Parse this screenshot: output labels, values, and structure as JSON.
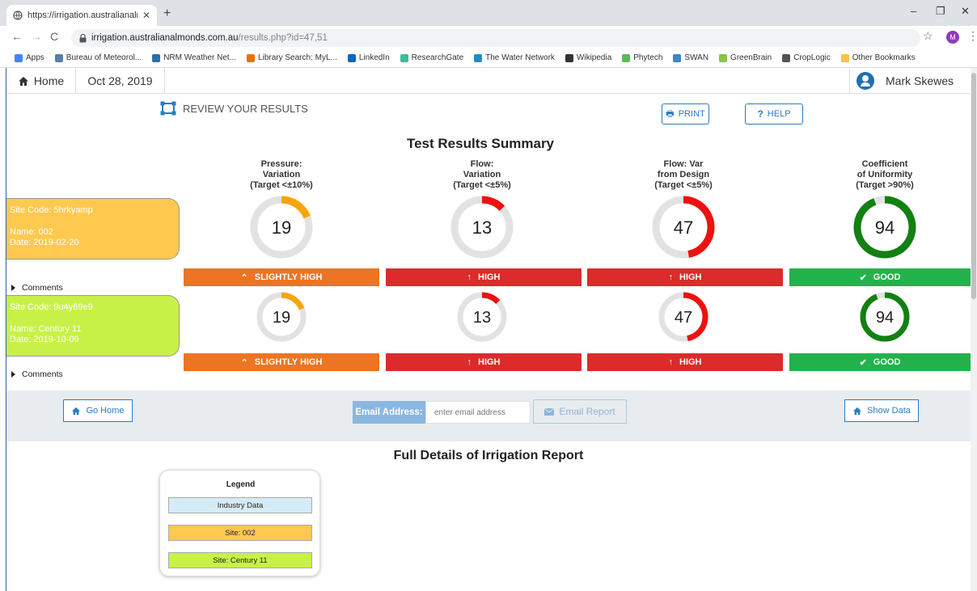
{
  "browser": {
    "tab_title": "https://irrigation.australianalmon",
    "url_host": "irrigation.australianalmonds.com.au",
    "url_path": "/results.php?id=47,51",
    "profile_initial": "M",
    "bookmarks": [
      {
        "label": "Apps",
        "color": "#4285f4"
      },
      {
        "label": "Bureau of Meteorol...",
        "color": "#5a7fa8"
      },
      {
        "label": "NRM Weather Net...",
        "color": "#2e6fa7"
      },
      {
        "label": "Library Search: MyL...",
        "color": "#e8710a"
      },
      {
        "label": "LinkedIn",
        "color": "#0a66c2"
      },
      {
        "label": "ResearchGate",
        "color": "#40ba9b"
      },
      {
        "label": "The Water Network",
        "color": "#1e8fc6"
      },
      {
        "label": "Wikipedia",
        "color": "#333333"
      },
      {
        "label": "Phytech",
        "color": "#5cb85c"
      },
      {
        "label": "SWAN",
        "color": "#3a86c8"
      },
      {
        "label": "GreenBrain",
        "color": "#8bc34a"
      },
      {
        "label": "CropLogic",
        "color": "#555555"
      },
      {
        "label": "Other Bookmarks",
        "color": "#f6c344"
      }
    ]
  },
  "header": {
    "home_label": "Home",
    "date": "Oct 28, 2019",
    "user_name": "Mark Skewes"
  },
  "toolbar": {
    "review_label": "REVIEW YOUR RESULTS",
    "print_label": "PRINT",
    "help_label": "HELP"
  },
  "summary": {
    "title": "Test Results Summary",
    "columns": [
      {
        "line1": "Pressure:",
        "line2": "Variation",
        "line3": "(Target <±10%)"
      },
      {
        "line1": "Flow:",
        "line2": "Variation",
        "line3": "(Target <±5%)"
      },
      {
        "line1": "Flow: Var",
        "line2": "from Design",
        "line3": "(Target <±5%)"
      },
      {
        "line1": "Coefficient",
        "line2": "of Uniformity",
        "line3": "(Target >90%)"
      }
    ],
    "sites": [
      {
        "site_code": "Site Code: 5hrkyamp",
        "name": "Name: 002",
        "date": "Date: 2019-02-20",
        "card_color": "#ffc94f",
        "comments_label": "Comments",
        "metrics": [
          {
            "value": "19",
            "fraction": 0.19,
            "ring_color": "#f6a50c",
            "status": "SLIGHTLY HIGH",
            "status_color": "#ed7423",
            "status_icon": "chevron-up-icon"
          },
          {
            "value": "13",
            "fraction": 0.13,
            "ring_color": "#ee1111",
            "status": "HIGH",
            "status_color": "#dd2a2a",
            "status_icon": "arrow-up-icon"
          },
          {
            "value": "47",
            "fraction": 0.47,
            "ring_color": "#ee1111",
            "status": "HIGH",
            "status_color": "#dd2a2a",
            "status_icon": "arrow-up-icon"
          },
          {
            "value": "94",
            "fraction": 0.94,
            "ring_color": "#128012",
            "status": "GOOD",
            "status_color": "#22b24c",
            "status_icon": "check-icon"
          }
        ]
      },
      {
        "site_code": "Site Code: 9u4y69e9",
        "name": "Name: Century 11",
        "date": "Date: 2019-10-09",
        "card_color": "#c8f148",
        "comments_label": "Comments",
        "metrics": [
          {
            "value": "19",
            "fraction": 0.19,
            "ring_color": "#f6a50c",
            "status": "SLIGHTLY HIGH",
            "status_color": "#ed7423",
            "status_icon": "chevron-up-icon"
          },
          {
            "value": "13",
            "fraction": 0.13,
            "ring_color": "#ee1111",
            "status": "HIGH",
            "status_color": "#dd2a2a",
            "status_icon": "arrow-up-icon"
          },
          {
            "value": "47",
            "fraction": 0.47,
            "ring_color": "#ee1111",
            "status": "HIGH",
            "status_color": "#dd2a2a",
            "status_icon": "arrow-up-icon"
          },
          {
            "value": "94",
            "fraction": 0.94,
            "ring_color": "#128012",
            "status": "GOOD",
            "status_color": "#22b24c",
            "status_icon": "check-icon"
          }
        ]
      }
    ]
  },
  "actions": {
    "go_home_label": "Go Home",
    "email_label": "Email Address:",
    "email_placeholder": "enter email address",
    "email_report_label": "Email Report",
    "show_data_label": "Show Data"
  },
  "details": {
    "title": "Full Details of Irrigation Report",
    "legend": {
      "title": "Legend",
      "items": [
        {
          "label": "Industry Data",
          "color": "#d6ebf8"
        },
        {
          "label": "Site: 002",
          "color": "#ffc94f"
        },
        {
          "label": "Site: Century 11",
          "color": "#c8f148"
        }
      ]
    }
  }
}
